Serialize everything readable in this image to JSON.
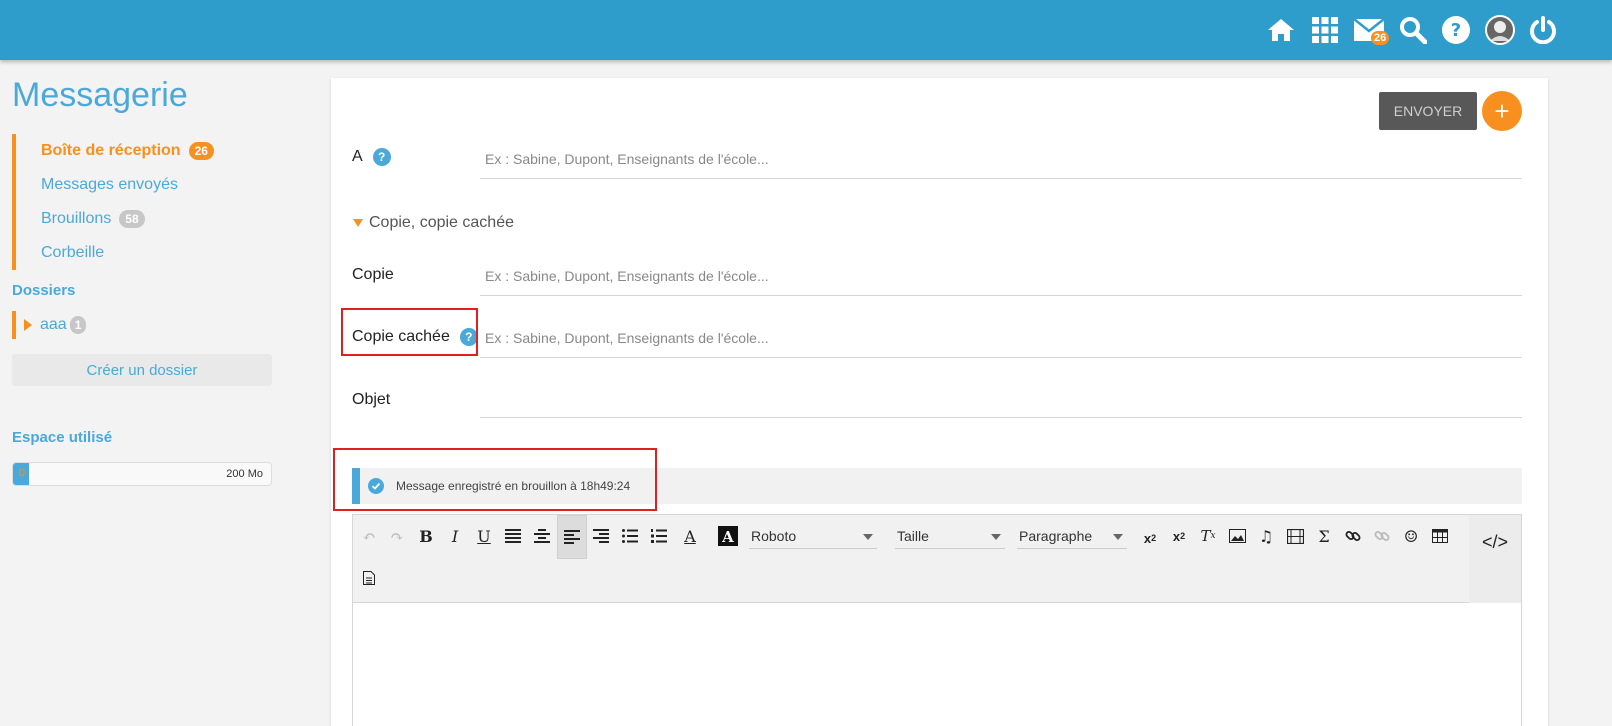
{
  "topbar": {
    "color": "#2e9dcc",
    "icons": [
      "home-icon",
      "apps-grid-icon",
      "mail-icon",
      "search-icon",
      "help-icon",
      "avatar",
      "power-icon"
    ],
    "mail_badge": "26"
  },
  "sidebar": {
    "title": "Messagerie",
    "items": [
      {
        "label": "Boîte de réception",
        "badge": "26",
        "active": true
      },
      {
        "label": "Messages envoyés"
      },
      {
        "label": "Brouillons",
        "badge": "58"
      },
      {
        "label": "Corbeille"
      }
    ],
    "folders_title": "Dossiers",
    "folders": [
      {
        "label": "aaa",
        "badge": "1"
      }
    ],
    "create_folder": "Créer un dossier",
    "storage_title": "Espace utilisé",
    "storage_used_label": "0",
    "storage_max_label": "200 Mo",
    "storage_used_fraction": 0.05
  },
  "compose": {
    "send_label": "ENVOYER",
    "plus_label": "+",
    "to_label": "A",
    "to_placeholder": "Ex : Sabine, Dupont, Enseignants de l'école...",
    "cc_toggle": "Copie, copie cachée",
    "cc_label": "Copie",
    "cc_placeholder": "Ex : Sabine, Dupont, Enseignants de l'école...",
    "bcc_label": "Copie cachée",
    "bcc_placeholder": "Ex : Sabine, Dupont, Enseignants de l'école...",
    "subject_label": "Objet",
    "subject_value": "",
    "draft_status": "Message enregistré en brouillon à 18h49:24"
  },
  "editor": {
    "font_select": "Roboto",
    "size_select": "Taille",
    "format_select": "Paragraphe",
    "source_label": "</>"
  },
  "colors": {
    "accent": "#4aa9d9",
    "orange": "#f7901e",
    "highlight_box": "#e02020"
  }
}
